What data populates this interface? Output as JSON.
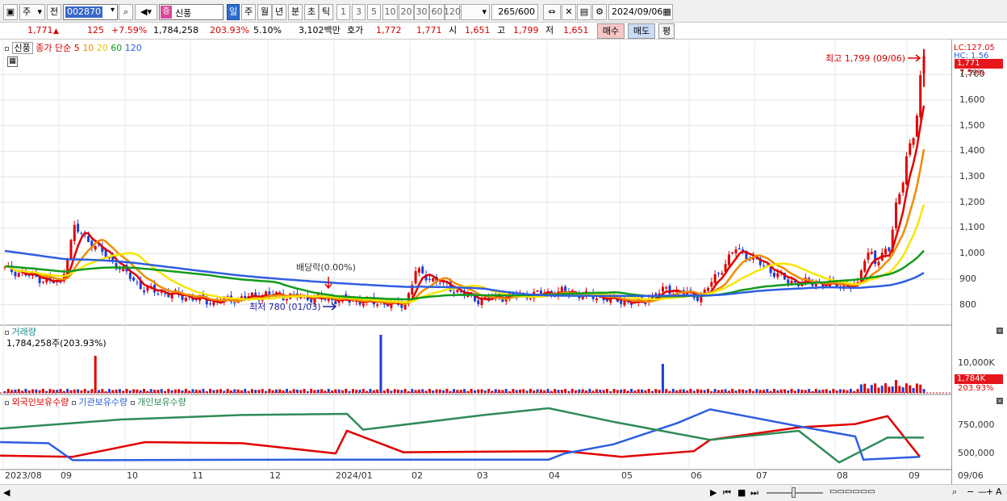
{
  "toolbar": {
    "market_label": "주",
    "prev_label": "전",
    "code": "002870",
    "stock_badge": "증",
    "stock_name": "신풍",
    "periods": [
      "일",
      "주",
      "월",
      "년",
      "분",
      "초",
      "틱"
    ],
    "minutes": [
      "1",
      "3",
      "5",
      "10",
      "20",
      "30",
      "60",
      "120"
    ],
    "count": "265",
    "count_total": "/600",
    "date": "2024/09/06"
  },
  "quote": {
    "price": "1,771",
    "change": "125",
    "change_pct": "+7.59%",
    "volume": "1,784,258",
    "volume_ratio": "203.93%",
    "turnover": "5.10%",
    "amount": "3,102백만",
    "hoga_label": "호가",
    "ask": "1,772",
    "bid": "1,771",
    "open_label": "시",
    "open": "1,651",
    "high_label": "고",
    "high": "1,799",
    "low_label": "저",
    "low": "1,651",
    "buy_label": "매수",
    "sell_label": "매도",
    "avg_label": "평"
  },
  "price_panel": {
    "name_tag": "신풍",
    "ma_label": "종가 단순",
    "ma_periods": [
      "5",
      "10",
      "20",
      "60",
      "120"
    ],
    "ma_colors": [
      "#e00000",
      "#f08c00",
      "#f5e600",
      "#129b1c",
      "#2e5ee0"
    ],
    "scale_top": "LC:127.05",
    "scale_second": "HC: 1.56",
    "current_price_tag": "1,771",
    "current_pct_tag": "7.59%",
    "high_annotation": "최고 1,799 (09/06)",
    "low_annotation": "최저 780 (01/03)",
    "dividend_annotation": "배당락(0.00%)"
  },
  "volume_panel": {
    "title": "거래량",
    "value": "1,784,258주(203.93%)",
    "scale_label": "10,000K",
    "current_tag": "1,784K",
    "current_pct": "203.93%"
  },
  "holdings_panel": {
    "legend": [
      "외국인보유수량",
      "기관보유수량",
      "개인보유수량"
    ],
    "colors": [
      "#e00000",
      "#2e5ee0",
      "#2e8b57"
    ],
    "scale_labels": [
      "750,000",
      "500,000"
    ]
  },
  "x_axis": {
    "labels": [
      "2023/08",
      "09",
      "10",
      "11",
      "12",
      "2024/01",
      "02",
      "03",
      "04",
      "05",
      "06",
      "07",
      "08",
      "09"
    ],
    "end_label": "09/06"
  },
  "chart_data": {
    "type": "candlestick",
    "y_ticks": [
      800,
      900,
      1000,
      1100,
      1200,
      1300,
      1400,
      1500,
      1600,
      1700
    ],
    "ylim": [
      720,
      1830
    ],
    "high": 1799,
    "low": 780,
    "last": 1771,
    "close_path": [
      {
        "x": "2023/08",
        "close": 940
      },
      {
        "x": "09",
        "close": 880
      },
      {
        "x": "09",
        "close": 1100
      },
      {
        "x": "10",
        "close": 860
      },
      {
        "x": "11",
        "close": 810
      },
      {
        "x": "11",
        "close": 840
      },
      {
        "x": "12",
        "close": 820
      },
      {
        "x": "2024/01",
        "close": 800
      },
      {
        "x": "2024/01",
        "close": 930
      },
      {
        "x": "02",
        "close": 820
      },
      {
        "x": "03",
        "close": 850
      },
      {
        "x": "04",
        "close": 805
      },
      {
        "x": "04",
        "close": 860
      },
      {
        "x": "05",
        "close": 830
      },
      {
        "x": "05",
        "close": 1020
      },
      {
        "x": "06",
        "close": 890
      },
      {
        "x": "07",
        "close": 880
      },
      {
        "x": "07",
        "close": 870
      },
      {
        "x": "08",
        "close": 1020
      },
      {
        "x": "08",
        "close": 950
      },
      {
        "x": "09",
        "close": 1400
      },
      {
        "x": "09/06",
        "close": 1771
      }
    ]
  }
}
